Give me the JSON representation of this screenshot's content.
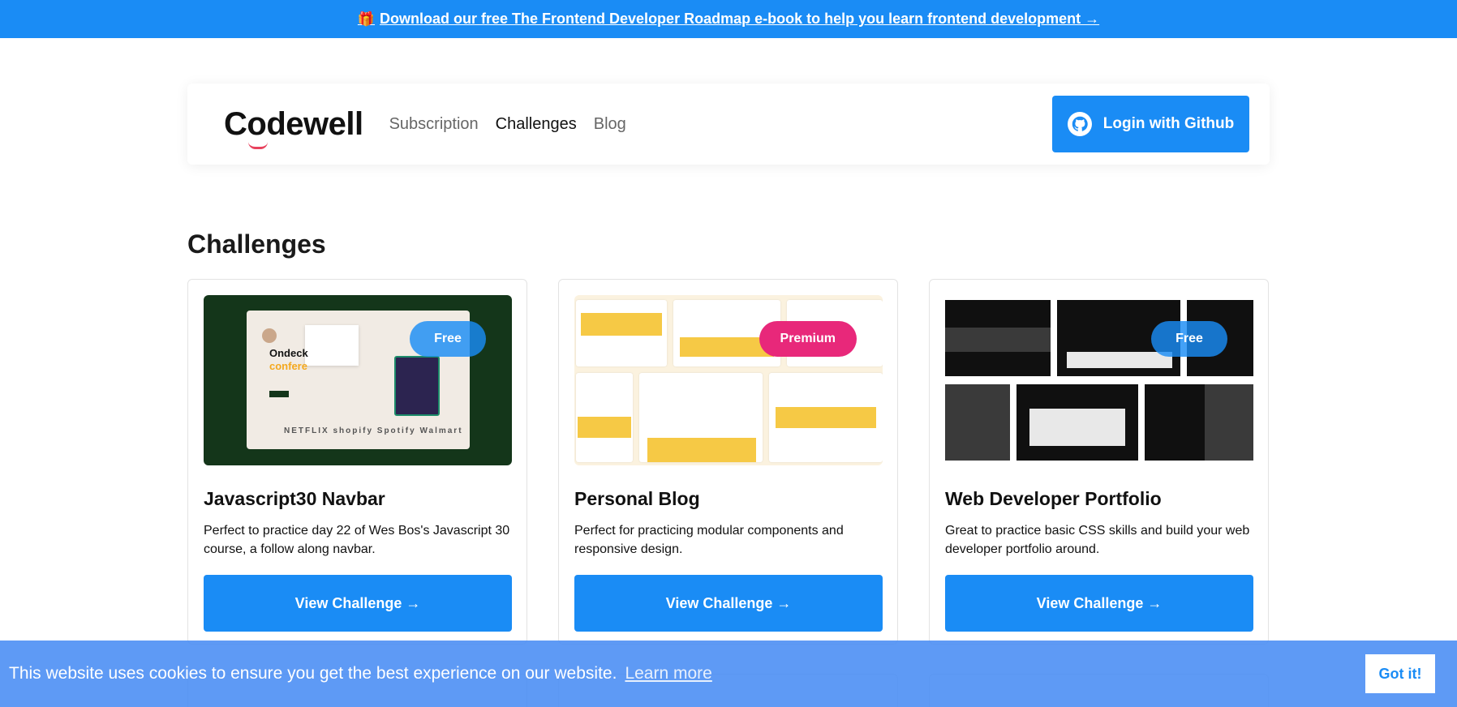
{
  "promo": {
    "icon": "gift-icon",
    "text": "Download our free The Frontend Developer Roadmap e-book to help you learn frontend development →"
  },
  "nav": {
    "logo": "Codewell",
    "links": [
      "Subscription",
      "Challenges",
      "Blog"
    ],
    "active": "Challenges",
    "login_label": "Login with Github"
  },
  "page": {
    "title": "Challenges"
  },
  "cards": [
    {
      "badge": "Free",
      "title": "Javascript30 Navbar",
      "description": "Perfect to practice day 22 of Wes Bos's Javascript 30 course, a follow along navbar.",
      "button": "View Challenge →",
      "thumb": {
        "heading1": "Ondeck",
        "heading2": "confere",
        "logos": "NETFLIX shopify Spotify Walmart"
      }
    },
    {
      "badge": "Premium",
      "title": "Personal Blog",
      "description": "Perfect for practicing modular components and responsive design.",
      "button": "View Challenge →"
    },
    {
      "badge": "Free",
      "title": "Web Developer Portfolio",
      "description": "Great to practice basic CSS skills and build your web developer portfolio around.",
      "button": "View Challenge →"
    }
  ],
  "cookie": {
    "text": "This website uses cookies to ensure you get the best experience on our website.",
    "link": "Learn more",
    "button": "Got it!"
  },
  "colors": {
    "primary": "#1a8cf5",
    "premium": "#e8287a",
    "logo_accent": "#e8425d"
  }
}
